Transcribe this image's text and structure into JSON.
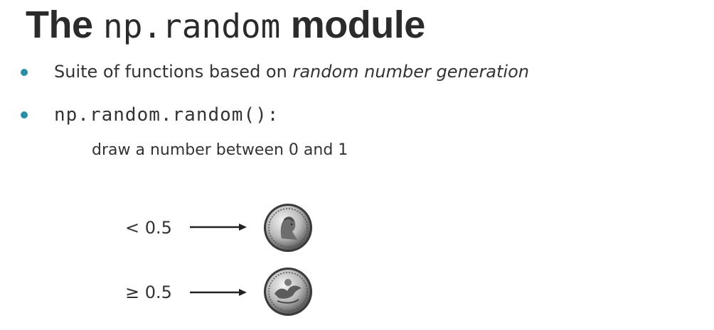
{
  "slide": {
    "title_prefix": "The",
    "title_code": "np.random",
    "title_suffix": "module"
  },
  "bullets": [
    {
      "text": "Suite of functions based on ",
      "emphasis": "random number generation"
    },
    {
      "code": "np.random.random():"
    }
  ],
  "subtext": "draw a number between 0 and 1",
  "outcomes": [
    {
      "condition": "< 0.5",
      "image": "coin-heads-icon"
    },
    {
      "condition": "≥ 0.5",
      "image": "coin-tails-icon"
    }
  ],
  "colors": {
    "bullet": "#2a8fa6",
    "text": "#333333",
    "title": "#2b2b2b"
  }
}
